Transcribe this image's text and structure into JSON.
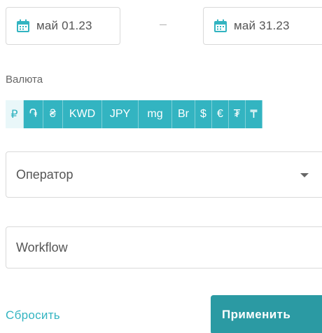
{
  "date_range": {
    "from": "май 01.23",
    "separator": "–",
    "to": "май 31.23"
  },
  "currency": {
    "label": "Валюта",
    "options": [
      {
        "symbol": "₽",
        "active": true
      },
      {
        "symbol": "֏"
      },
      {
        "symbol": "₴"
      },
      {
        "symbol": "KWD"
      },
      {
        "symbol": "JPY"
      },
      {
        "symbol": "mg"
      },
      {
        "symbol": "Br"
      },
      {
        "symbol": "$"
      },
      {
        "symbol": "€"
      },
      {
        "symbol": "₮"
      },
      {
        "symbol": "₸"
      }
    ]
  },
  "operator_select": {
    "value": "Оператор"
  },
  "workflow_input": {
    "placeholder": "Workflow"
  },
  "actions": {
    "reset_label": "Сбросить",
    "apply_label": "Применить"
  },
  "colors": {
    "accent": "#33b4c1",
    "apply_button": "#2b9aa3",
    "border": "#d9d9d9"
  }
}
